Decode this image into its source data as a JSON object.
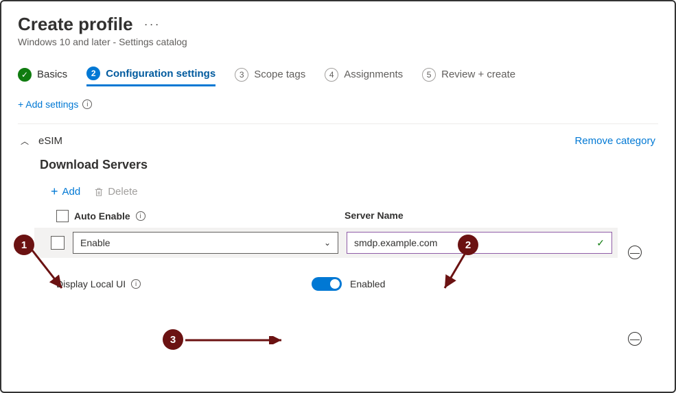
{
  "header": {
    "title": "Create profile",
    "subtitle": "Windows 10 and later - Settings catalog"
  },
  "steps": [
    {
      "label": "Basics",
      "state": "done"
    },
    {
      "label": "Configuration settings",
      "num": "2",
      "state": "active"
    },
    {
      "label": "Scope tags",
      "num": "3",
      "state": "pending"
    },
    {
      "label": "Assignments",
      "num": "4",
      "state": "pending"
    },
    {
      "label": "Review + create",
      "num": "5",
      "state": "pending"
    }
  ],
  "addSettings": "+ Add settings",
  "category": {
    "name": "eSIM",
    "removeLabel": "Remove category",
    "section": "Download Servers",
    "addLabel": "Add",
    "deleteLabel": "Delete",
    "col1": "Auto Enable",
    "col2": "Server Name",
    "row": {
      "autoEnable": "Enable",
      "serverName": "smdp.example.com"
    },
    "displayLocalUI": {
      "label": "Display Local UI",
      "value": "Enabled"
    }
  },
  "callouts": {
    "c1": "1",
    "c2": "2",
    "c3": "3"
  }
}
